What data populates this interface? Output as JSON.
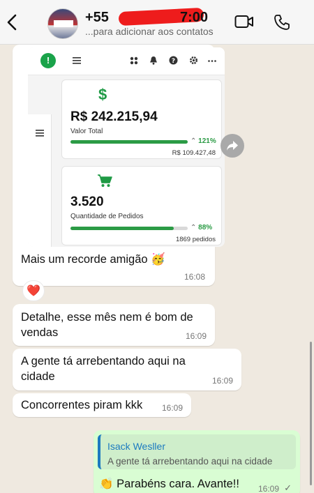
{
  "header": {
    "name_prefix": "+55",
    "name_suffix": "7:00",
    "subtitle": "...para adicionar aos contatos"
  },
  "dashboard": {
    "card1": {
      "value": "R$ 242.215,94",
      "label": "Valor Total",
      "percent": "121%",
      "secondary": "R$ 109.427,48",
      "progress_fraction": 1.0
    },
    "card2": {
      "value": "3.520",
      "label": "Quantidade de Pedidos",
      "percent": "88%",
      "secondary": "1869 pedidos",
      "progress_fraction": 0.88
    },
    "colors": {
      "green": "#2b9b45",
      "bar_bg": "#d9d9d9"
    }
  },
  "messages": [
    {
      "text": "Mais um recorde amigão",
      "emoji": "🥳",
      "time": "16:08"
    },
    {
      "reaction": "❤️"
    },
    {
      "text": "Detalhe, esse mês nem é bom de vendas",
      "time": "16:09"
    },
    {
      "text": "A gente tá arrebentando aqui na cidade",
      "time": "16:09"
    },
    {
      "text": "Concorrentes piram kkk",
      "time": "16:09"
    }
  ],
  "reply": {
    "quoted_author": "Isack Wesller",
    "quoted_text": "A gente tá arrebentando aqui na cidade",
    "emoji": "👏",
    "text": "Parabéns cara. Avante!!",
    "time": "16:09",
    "status": "✓"
  },
  "icons": [
    "back-chevron-icon",
    "video-call-icon",
    "phone-icon",
    "share-forward-icon"
  ]
}
